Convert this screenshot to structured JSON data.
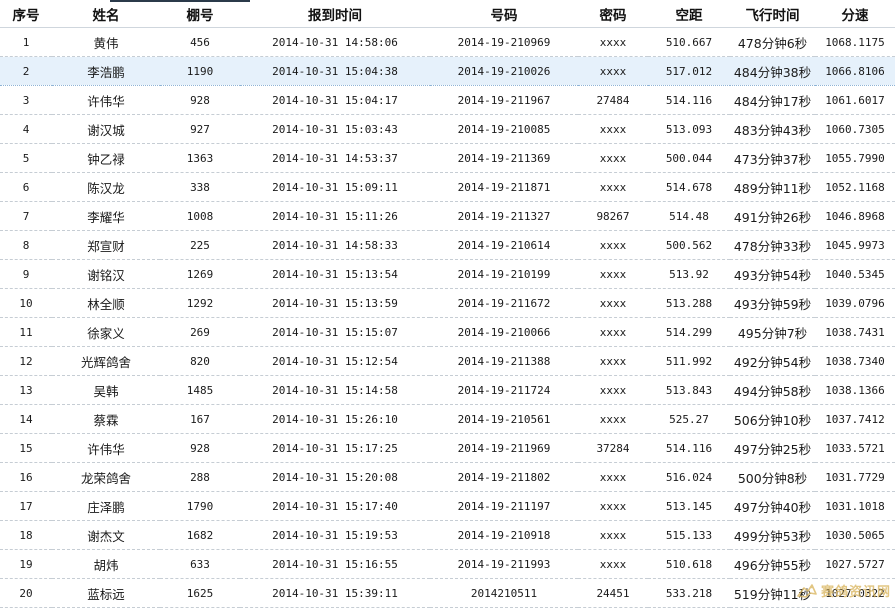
{
  "table": {
    "headers": [
      "序号",
      "姓名",
      "棚号",
      "报到时间",
      "号码",
      "密码",
      "空距",
      "飞行时间",
      "分速"
    ],
    "selected_row": 1,
    "rows": [
      [
        "1",
        "黄伟",
        "456",
        "2014-10-31 14:58:06",
        "2014-19-210969",
        "xxxx",
        "510.667",
        "478分钟6秒",
        "1068.1175"
      ],
      [
        "2",
        "李浩鹏",
        "1190",
        "2014-10-31 15:04:38",
        "2014-19-210026",
        "xxxx",
        "517.012",
        "484分钟38秒",
        "1066.8106"
      ],
      [
        "3",
        "许伟华",
        "928",
        "2014-10-31 15:04:17",
        "2014-19-211967",
        "27484",
        "514.116",
        "484分钟17秒",
        "1061.6017"
      ],
      [
        "4",
        "谢汉城",
        "927",
        "2014-10-31 15:03:43",
        "2014-19-210085",
        "xxxx",
        "513.093",
        "483分钟43秒",
        "1060.7305"
      ],
      [
        "5",
        "钟乙禄",
        "1363",
        "2014-10-31 14:53:37",
        "2014-19-211369",
        "xxxx",
        "500.044",
        "473分钟37秒",
        "1055.7990"
      ],
      [
        "6",
        "陈汉龙",
        "338",
        "2014-10-31 15:09:11",
        "2014-19-211871",
        "xxxx",
        "514.678",
        "489分钟11秒",
        "1052.1168"
      ],
      [
        "7",
        "李耀华",
        "1008",
        "2014-10-31 15:11:26",
        "2014-19-211327",
        "98267",
        "514.48",
        "491分钟26秒",
        "1046.8968"
      ],
      [
        "8",
        "郑宣财",
        "225",
        "2014-10-31 14:58:33",
        "2014-19-210614",
        "xxxx",
        "500.562",
        "478分钟33秒",
        "1045.9973"
      ],
      [
        "9",
        "谢铭汉",
        "1269",
        "2014-10-31 15:13:54",
        "2014-19-210199",
        "xxxx",
        "513.92",
        "493分钟54秒",
        "1040.5345"
      ],
      [
        "10",
        "林全顺",
        "1292",
        "2014-10-31 15:13:59",
        "2014-19-211672",
        "xxxx",
        "513.288",
        "493分钟59秒",
        "1039.0796"
      ],
      [
        "11",
        "徐家义",
        "269",
        "2014-10-31 15:15:07",
        "2014-19-210066",
        "xxxx",
        "514.299",
        "495分钟7秒",
        "1038.7431"
      ],
      [
        "12",
        "光辉鸽舍",
        "820",
        "2014-10-31 15:12:54",
        "2014-19-211388",
        "xxxx",
        "511.992",
        "492分钟54秒",
        "1038.7340"
      ],
      [
        "13",
        "吴韩",
        "1485",
        "2014-10-31 15:14:58",
        "2014-19-211724",
        "xxxx",
        "513.843",
        "494分钟58秒",
        "1038.1366"
      ],
      [
        "14",
        "蔡霖",
        "167",
        "2014-10-31 15:26:10",
        "2014-19-210561",
        "xxxx",
        "525.27",
        "506分钟10秒",
        "1037.7412"
      ],
      [
        "15",
        "许伟华",
        "928",
        "2014-10-31 15:17:25",
        "2014-19-211969",
        "37284",
        "514.116",
        "497分钟25秒",
        "1033.5721"
      ],
      [
        "16",
        "龙荣鸽舍",
        "288",
        "2014-10-31 15:20:08",
        "2014-19-211802",
        "xxxx",
        "516.024",
        "500分钟8秒",
        "1031.7729"
      ],
      [
        "17",
        "庄泽鹏",
        "1790",
        "2014-10-31 15:17:40",
        "2014-19-211197",
        "xxxx",
        "513.145",
        "497分钟40秒",
        "1031.1018"
      ],
      [
        "18",
        "谢杰文",
        "1682",
        "2014-10-31 15:19:53",
        "2014-19-210918",
        "xxxx",
        "515.133",
        "499分钟53秒",
        "1030.5065"
      ],
      [
        "19",
        "胡炜",
        "633",
        "2014-10-31 15:16:55",
        "2014-19-211993",
        "xxxx",
        "510.618",
        "496分钟55秒",
        "1027.5727"
      ],
      [
        "20",
        "蓝标远",
        "1625",
        "2014-10-31 15:39:11",
        "2014210511",
        "24451",
        "533.218",
        "519分钟11秒",
        "1027.0322"
      ]
    ]
  },
  "watermark": {
    "text": "赛鸽资讯网",
    "color": "#d9b45a",
    "icon": "pigeon-logo-icon"
  }
}
